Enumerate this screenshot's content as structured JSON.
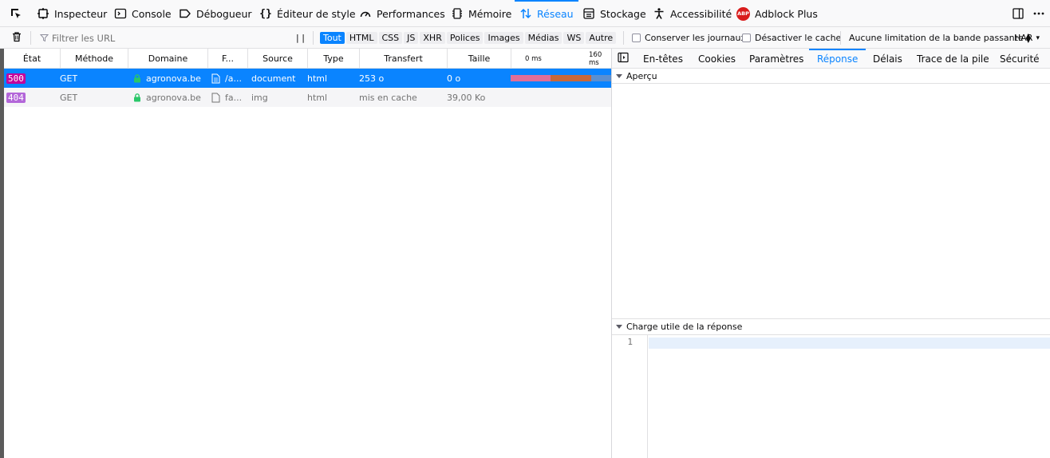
{
  "toolbar": {
    "tabs": [
      {
        "label": "Inspecteur",
        "icon": "inspector-icon"
      },
      {
        "label": "Console",
        "icon": "console-icon"
      },
      {
        "label": "Débogueur",
        "icon": "debugger-icon"
      },
      {
        "label": "Éditeur de style",
        "icon": "style-editor-icon"
      },
      {
        "label": "Performances",
        "icon": "performance-icon"
      },
      {
        "label": "Mémoire",
        "icon": "memory-icon"
      },
      {
        "label": "Réseau",
        "icon": "network-icon",
        "active": true
      },
      {
        "label": "Stockage",
        "icon": "storage-icon"
      },
      {
        "label": "Accessibilité",
        "icon": "accessibility-icon"
      },
      {
        "label": "Adblock Plus",
        "icon": "adblock-plus-icon"
      }
    ],
    "abp_badge": "ABP"
  },
  "filterbar": {
    "filter_placeholder": "Filtrer les URL",
    "pause_label": "| |",
    "types": [
      "Tout",
      "HTML",
      "CSS",
      "JS",
      "XHR",
      "Polices",
      "Images",
      "Médias",
      "WS",
      "Autre"
    ],
    "active_type": "Tout",
    "persist_logs": "Conserver les journaux",
    "disable_cache": "Désactiver le cache",
    "throttling": "Aucune limitation de la bande passante",
    "har": "HAR"
  },
  "columns": [
    "État",
    "Méthode",
    "Domaine",
    "F...",
    "Source",
    "Type",
    "Transfert",
    "Taille"
  ],
  "waterfall_ticks": [
    "0 ms",
    "160 ms"
  ],
  "requests": [
    {
      "status": "500",
      "method": "GET",
      "domain": "agronova.be",
      "file": "/a...",
      "source": "document",
      "type": "html",
      "transfer": "253 o",
      "size": "0 o",
      "selected": true
    },
    {
      "status": "404",
      "method": "GET",
      "domain": "agronova.be",
      "file": "fa...",
      "source": "img",
      "type": "html",
      "transfer": "mis en cache",
      "size": "39,00 Ko",
      "selected": false
    }
  ],
  "details": {
    "tabs": [
      "En-têtes",
      "Cookies",
      "Paramètres",
      "Réponse",
      "Délais",
      "Trace de la pile",
      "Sécurité"
    ],
    "active_tab": "Réponse",
    "preview_section": "Aperçu",
    "payload_section": "Charge utile de la réponse",
    "line_number": "1"
  },
  "colors": {
    "accent": "#0a84ff",
    "status_500": "#c4009b",
    "status_404": "#b366d9",
    "lock": "#2ac769"
  }
}
